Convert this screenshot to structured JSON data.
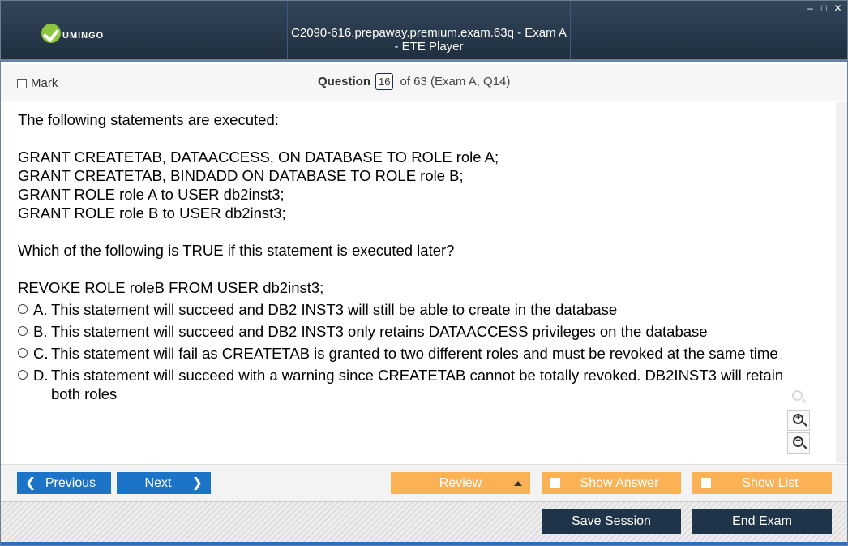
{
  "window": {
    "logo_text": "UMINGO",
    "title": "C2090-616.prepaway.premium.exam.63q - Exam A - ETE Player",
    "controls": {
      "minimize": "–",
      "maximize": "□",
      "close": "✕"
    }
  },
  "header": {
    "mark_label": "Mark",
    "question_label": "Question",
    "question_number": "16",
    "question_suffix": "of 63 (Exam A, Q14)"
  },
  "question": {
    "lines": [
      "The following statements are executed:",
      "",
      "GRANT CREATETAB, DATAACCESS, ON DATABASE TO ROLE role A;",
      "GRANT CREATETAB, BINDADD ON DATABASE TO ROLE role B;",
      "GRANT ROLE role A to USER db2inst3;",
      "GRANT ROLE role B to USER db2inst3;",
      "",
      "Which of the following is TRUE if this statement is executed later?",
      "",
      "REVOKE ROLE roleB FROM USER db2inst3;"
    ],
    "options": [
      {
        "letter": "A.",
        "text": "This statement will succeed and DB2 INST3 will still be able to create in the database"
      },
      {
        "letter": "B.",
        "text": "This statement will succeed and DB2 INST3 only retains DATAACCESS privileges on the database"
      },
      {
        "letter": "C.",
        "text": "This statement will fail as CREATETAB is granted to two different roles and must be revoked at the same time"
      },
      {
        "letter": "D.",
        "text": "This statement will succeed with a warning since CREATETAB cannot be totally revoked. DB2INST3 will retain both roles"
      }
    ]
  },
  "nav": {
    "previous_label": "Previous",
    "next_label": "Next",
    "review_label": "Review",
    "show_answer_label": "Show Answer",
    "show_list_label": "Show List"
  },
  "footer": {
    "save_label": "Save Session",
    "end_label": "End Exam"
  },
  "colors": {
    "titlebar": "#1f2f40",
    "accent_blue": "#1b74c8",
    "accent_orange": "#fbb254",
    "dark_button": "#1f3449"
  }
}
